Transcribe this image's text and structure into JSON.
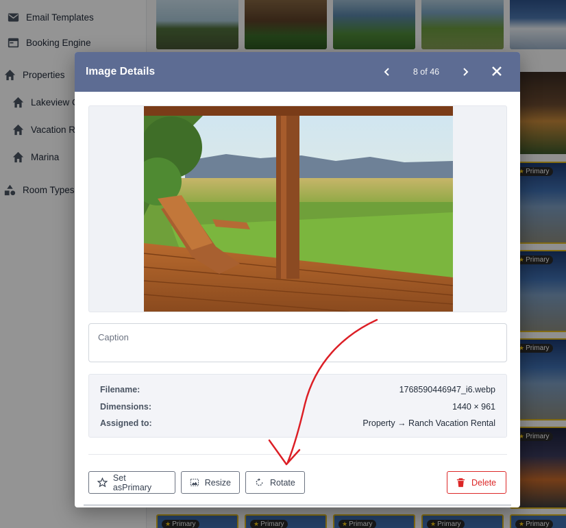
{
  "sidebar": {
    "items": [
      {
        "label": "Email Templates",
        "icon": "mail-icon"
      },
      {
        "label": "Booking Engine",
        "icon": "browser-icon"
      },
      {
        "label": "Properties",
        "icon": "home-icon"
      },
      {
        "label": "Lakeview Ca",
        "icon": "home-icon"
      },
      {
        "label": "Vacation Re",
        "icon": "home-icon"
      },
      {
        "label": "Marina",
        "icon": "home-icon"
      },
      {
        "label": "Room Types",
        "icon": "shapes-icon"
      }
    ]
  },
  "gallery": {
    "badge_label": "Primary"
  },
  "modal": {
    "title": "Image Details",
    "counter": "8 of 46",
    "caption_placeholder": "Caption",
    "info": {
      "filename_label": "Filename:",
      "filename_value": "1768590446947_i6.webp",
      "dimensions_label": "Dimensions:",
      "dimensions_value": "1440 × 961",
      "assigned_label": "Assigned to:",
      "assigned_value": "Property → Ranch Vacation Rental"
    },
    "buttons": {
      "set_primary": "Set asPrimary",
      "resize": "Resize",
      "rotate": "Rotate",
      "delete": "Delete"
    }
  },
  "colors": {
    "header_bg": "#5d6c93",
    "delete": "#dc2626",
    "annotation_arrow": "#dc1f26",
    "badge_star": "#facc15"
  }
}
